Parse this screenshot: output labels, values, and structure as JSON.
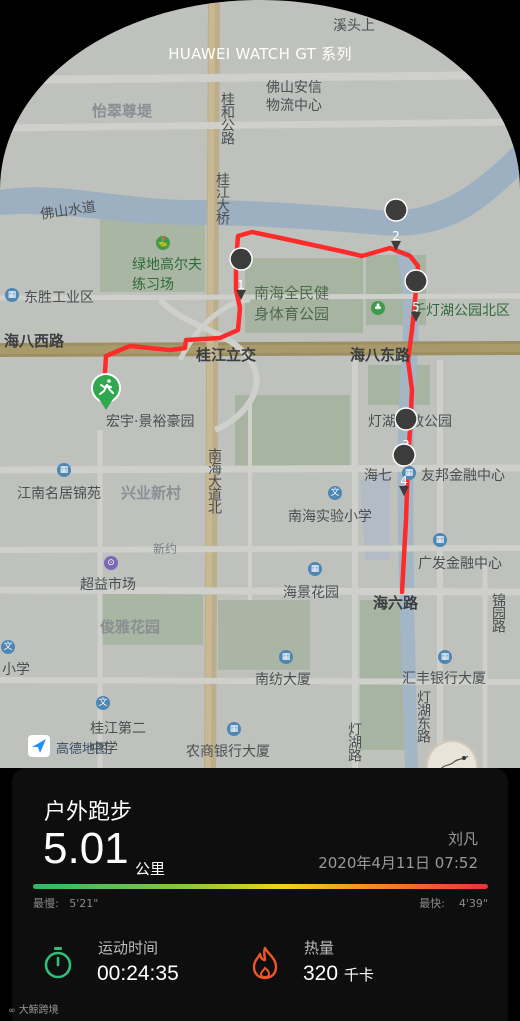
{
  "header": {
    "device_title": "HUAWEI WATCH GT 系列"
  },
  "map": {
    "labels": {
      "xishang": "溪头上",
      "foshan_anxin": "佛山安信",
      "wuliu": "物流中心",
      "cuizuntai": "怡翠尊堤",
      "guihe_road": "桂和公路",
      "guijiang_bridge": "桂江大桥",
      "foshan_water": "佛山水道",
      "golf": "绿地高尔夫练习场",
      "dongsheng": "东胜工业区",
      "nanhai_fitness": "南海全民健身体育公园",
      "qiandeng_park": "千灯湖公园北区",
      "haiba_west": "海八西路",
      "guijiang_interchange": "桂江立交",
      "haiba_east": "海八东路",
      "hongyu": "宏宇·景裕豪园",
      "denghu_park": "灯湖市政公园",
      "haiqi": "海七",
      "youbang": "友邦金融中心",
      "jiangnan": "江南名居锦苑",
      "xingye": "兴业新村",
      "nanhai_ave": "南海大道北",
      "nanhai_school": "南海实验小学",
      "xinyue": "新约",
      "guangfa": "广发金融中心",
      "chaoyi": "超益市场",
      "haijing": "海景花园",
      "hailiu": "海六路",
      "jinyuan_road": "锦园路",
      "junya": "俊雅花园",
      "xiaoxue": "小学",
      "nanfang": "南纺大厦",
      "huifeng": "汇丰银行大厦",
      "guijiang_two": "桂江第二中学",
      "nonghang": "农商银行大厦",
      "denghu_east": "灯湖东路",
      "denghu_road": "灯湖路"
    },
    "km_markers": [
      "1",
      "2",
      "3",
      "4",
      "5"
    ],
    "amap_brand": "高德地图"
  },
  "summary": {
    "activity_title": "户外跑步",
    "distance_value": "5.01",
    "distance_unit": "公里",
    "user_name": "刘凡",
    "datetime": "2020年4月11日 07:52",
    "pace_slow_label": "最慢:",
    "pace_slow_value": "5'21\"",
    "pace_fast_label": "最快:",
    "pace_fast_value": "4'39\""
  },
  "stats": {
    "duration_label": "运动时间",
    "duration_value": "00:24:35",
    "calories_label": "热量",
    "calories_value": "320",
    "calories_unit": "千卡"
  },
  "watermark": "大鲸跨境",
  "colors": {
    "route": "#ff2a2a",
    "pace_fast": "#e8323a",
    "pace_slow": "#2fb86a",
    "icon_green": "#2fbf7a",
    "icon_orange": "#f0552a"
  },
  "icons": [
    "running-man-icon",
    "location-pin-icon",
    "stopwatch-icon",
    "flame-icon",
    "amap-logo-icon",
    "moon-icon"
  ]
}
